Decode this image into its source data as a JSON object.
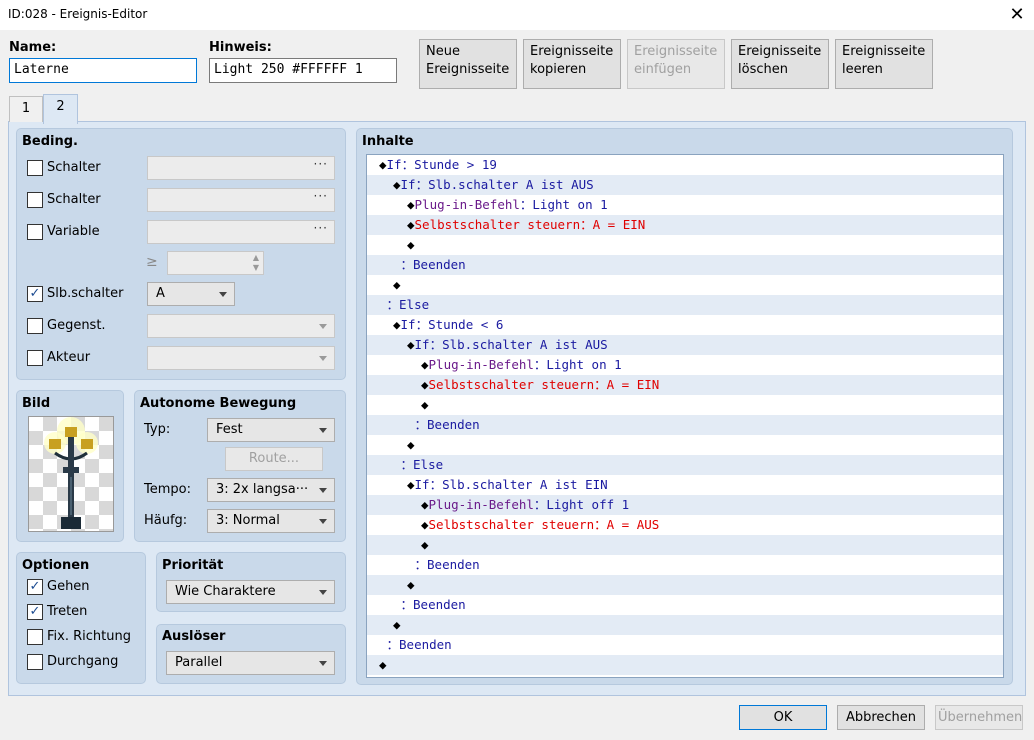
{
  "window": {
    "title": "ID:028 - Ereignis-Editor",
    "close": "✕"
  },
  "header": {
    "name_label": "Name:",
    "name_value": "Laterne",
    "note_label": "Hinweis:",
    "note_value": "Light 250 #FFFFFF 1",
    "buttons": {
      "new": [
        "Neue",
        "Ereignisseite"
      ],
      "copy": [
        "Ereignisseite",
        "kopieren"
      ],
      "paste": [
        "Ereignisseite",
        "einfügen"
      ],
      "delete": [
        "Ereignisseite",
        "löschen"
      ],
      "clear": [
        "Ereignisseite",
        "leeren"
      ]
    }
  },
  "tabs": [
    "1",
    "2"
  ],
  "conditions": {
    "title": "Beding.",
    "switch1": "Schalter",
    "switch2": "Schalter",
    "variable": "Variable",
    "gte": "≥",
    "selfswitch": "Slb.schalter",
    "selfswitch_value": "A",
    "item": "Gegenst.",
    "actor": "Akteur",
    "ellipsis": "···"
  },
  "image": {
    "title": "Bild"
  },
  "movement": {
    "title": "Autonome Bewegung",
    "type_label": "Typ:",
    "type_value": "Fest",
    "route_button": "Route...",
    "speed_label": "Tempo:",
    "speed_value": "3: 2x langsa···",
    "freq_label": "Häufg:",
    "freq_value": "3: Normal"
  },
  "options": {
    "title": "Optionen",
    "walk": "Gehen",
    "step": "Treten",
    "fixdir": "Fix. Richtung",
    "through": "Durchgang"
  },
  "priority": {
    "title": "Priorität",
    "value": "Wie Charaktere"
  },
  "trigger": {
    "title": "Auslöser",
    "value": "Parallel"
  },
  "contents": {
    "title": "Inhalte",
    "lines": [
      {
        "indent": 0,
        "dia": "◆",
        "parts": [
          [
            "If：Stunde > 19",
            "blue"
          ]
        ]
      },
      {
        "indent": 1,
        "dia": "◆",
        "parts": [
          [
            "If：Slb.schalter A ist AUS",
            "blue"
          ]
        ]
      },
      {
        "indent": 2,
        "dia": "◆",
        "parts": [
          [
            "Plug-in-Befehl",
            "purple"
          ],
          [
            "：Light on 1",
            "blue"
          ]
        ]
      },
      {
        "indent": 2,
        "dia": "◆",
        "parts": [
          [
            "Selbstschalter steuern：A = EIN",
            "red"
          ]
        ]
      },
      {
        "indent": 2,
        "dia": "◆",
        "parts": []
      },
      {
        "indent": 1,
        "dia": "",
        "parts": [
          [
            "：Beenden",
            "blue"
          ]
        ]
      },
      {
        "indent": 1,
        "dia": "◆",
        "parts": []
      },
      {
        "indent": 0,
        "dia": "",
        "parts": [
          [
            "：Else",
            "blue"
          ]
        ]
      },
      {
        "indent": 1,
        "dia": "◆",
        "parts": [
          [
            "If：Stunde < 6",
            "blue"
          ]
        ]
      },
      {
        "indent": 2,
        "dia": "◆",
        "parts": [
          [
            "If：Slb.schalter A ist AUS",
            "blue"
          ]
        ]
      },
      {
        "indent": 3,
        "dia": "◆",
        "parts": [
          [
            "Plug-in-Befehl",
            "purple"
          ],
          [
            "：Light on 1",
            "blue"
          ]
        ]
      },
      {
        "indent": 3,
        "dia": "◆",
        "parts": [
          [
            "Selbstschalter steuern：A = EIN",
            "red"
          ]
        ]
      },
      {
        "indent": 3,
        "dia": "◆",
        "parts": []
      },
      {
        "indent": 2,
        "dia": "",
        "parts": [
          [
            "：Beenden",
            "blue"
          ]
        ]
      },
      {
        "indent": 2,
        "dia": "◆",
        "parts": []
      },
      {
        "indent": 1,
        "dia": "",
        "parts": [
          [
            "：Else",
            "blue"
          ]
        ]
      },
      {
        "indent": 2,
        "dia": "◆",
        "parts": [
          [
            "If：Slb.schalter A ist EIN",
            "blue"
          ]
        ]
      },
      {
        "indent": 3,
        "dia": "◆",
        "parts": [
          [
            "Plug-in-Befehl",
            "purple"
          ],
          [
            "：Light off 1",
            "blue"
          ]
        ]
      },
      {
        "indent": 3,
        "dia": "◆",
        "parts": [
          [
            "Selbstschalter steuern：A = AUS",
            "red"
          ]
        ]
      },
      {
        "indent": 3,
        "dia": "◆",
        "parts": []
      },
      {
        "indent": 2,
        "dia": "",
        "parts": [
          [
            "：Beenden",
            "blue"
          ]
        ]
      },
      {
        "indent": 2,
        "dia": "◆",
        "parts": []
      },
      {
        "indent": 1,
        "dia": "",
        "parts": [
          [
            "：Beenden",
            "blue"
          ]
        ]
      },
      {
        "indent": 1,
        "dia": "◆",
        "parts": []
      },
      {
        "indent": 0,
        "dia": "",
        "parts": [
          [
            "：Beenden",
            "blue"
          ]
        ]
      },
      {
        "indent": 0,
        "dia": "◆",
        "parts": []
      }
    ]
  },
  "footer": {
    "ok": "OK",
    "cancel": "Abbrechen",
    "apply": "Übernehmen"
  }
}
